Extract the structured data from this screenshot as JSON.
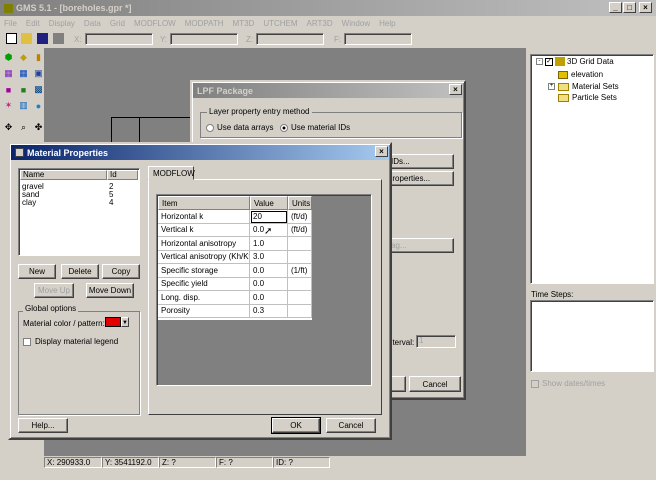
{
  "app": {
    "title": "GMS 5.1 - [boreholes.gpr *]"
  },
  "menu": [
    "File",
    "Edit",
    "Display",
    "Data",
    "Grid",
    "MODFLOW",
    "MODPATH",
    "MT3D",
    "UTCHEM",
    "ART3D",
    "Window",
    "Help"
  ],
  "coords": {
    "x": "X:",
    "y": "Y:",
    "z": "Z:",
    "f": "F:"
  },
  "tree": {
    "root": "3D Grid Data",
    "items": [
      "elevation",
      "Material Sets",
      "Particle Sets"
    ]
  },
  "time_steps": {
    "label": "Time Steps:",
    "show_dates": "Show dates/times"
  },
  "status": {
    "x": "X: 290933.0",
    "y": "Y: 3541192.0",
    "z": "Z: ?",
    "f": "F: ?",
    "id": "ID: ?"
  },
  "lpf": {
    "title": "LPF Package",
    "group_label": "Layer property entry method",
    "radio1": "Use data arrays",
    "radio2": "Use material IDs",
    "btn_ids": "IDs...",
    "btn_props": "Properties...",
    "btn_flag": "flag...",
    "interval_label": "nterval:",
    "interval_value": "1",
    "cancel": "Cancel"
  },
  "mat": {
    "title": "Material Properties",
    "list_headers": {
      "name": "Name",
      "id": "Id"
    },
    "materials": [
      {
        "name": "gravel",
        "id": "2"
      },
      {
        "name": "sand",
        "id": "5"
      },
      {
        "name": "clay",
        "id": "4"
      }
    ],
    "new": "New",
    "delete": "Delete",
    "copy": "Copy",
    "move_up": "Move Up",
    "move_down": "Move Down",
    "global_label": "Global options",
    "color_label": "Material color / pattern:",
    "color": "#e00000",
    "legend_label": "Display material legend",
    "tab": "MODFLOW",
    "grid_headers": {
      "item": "Item",
      "value": "Value",
      "units": "Units"
    },
    "rows": [
      {
        "item": "Horizontal k",
        "value": "20",
        "units": "(ft/d)"
      },
      {
        "item": "Vertical k",
        "value": "0.0",
        "units": "(ft/d)"
      },
      {
        "item": "Horizontal anisotropy",
        "value": "1.0",
        "units": ""
      },
      {
        "item": "Vertical anisotropy (Kh/Kv)",
        "value": "3.0",
        "units": ""
      },
      {
        "item": "Specific storage",
        "value": "0.0",
        "units": "(1/ft)"
      },
      {
        "item": "Specific yield",
        "value": "0.0",
        "units": ""
      },
      {
        "item": "Long. disp.",
        "value": "0.0",
        "units": ""
      },
      {
        "item": "Porosity",
        "value": "0.3",
        "units": ""
      }
    ],
    "help": "Help...",
    "ok": "OK",
    "cancel": "Cancel"
  }
}
